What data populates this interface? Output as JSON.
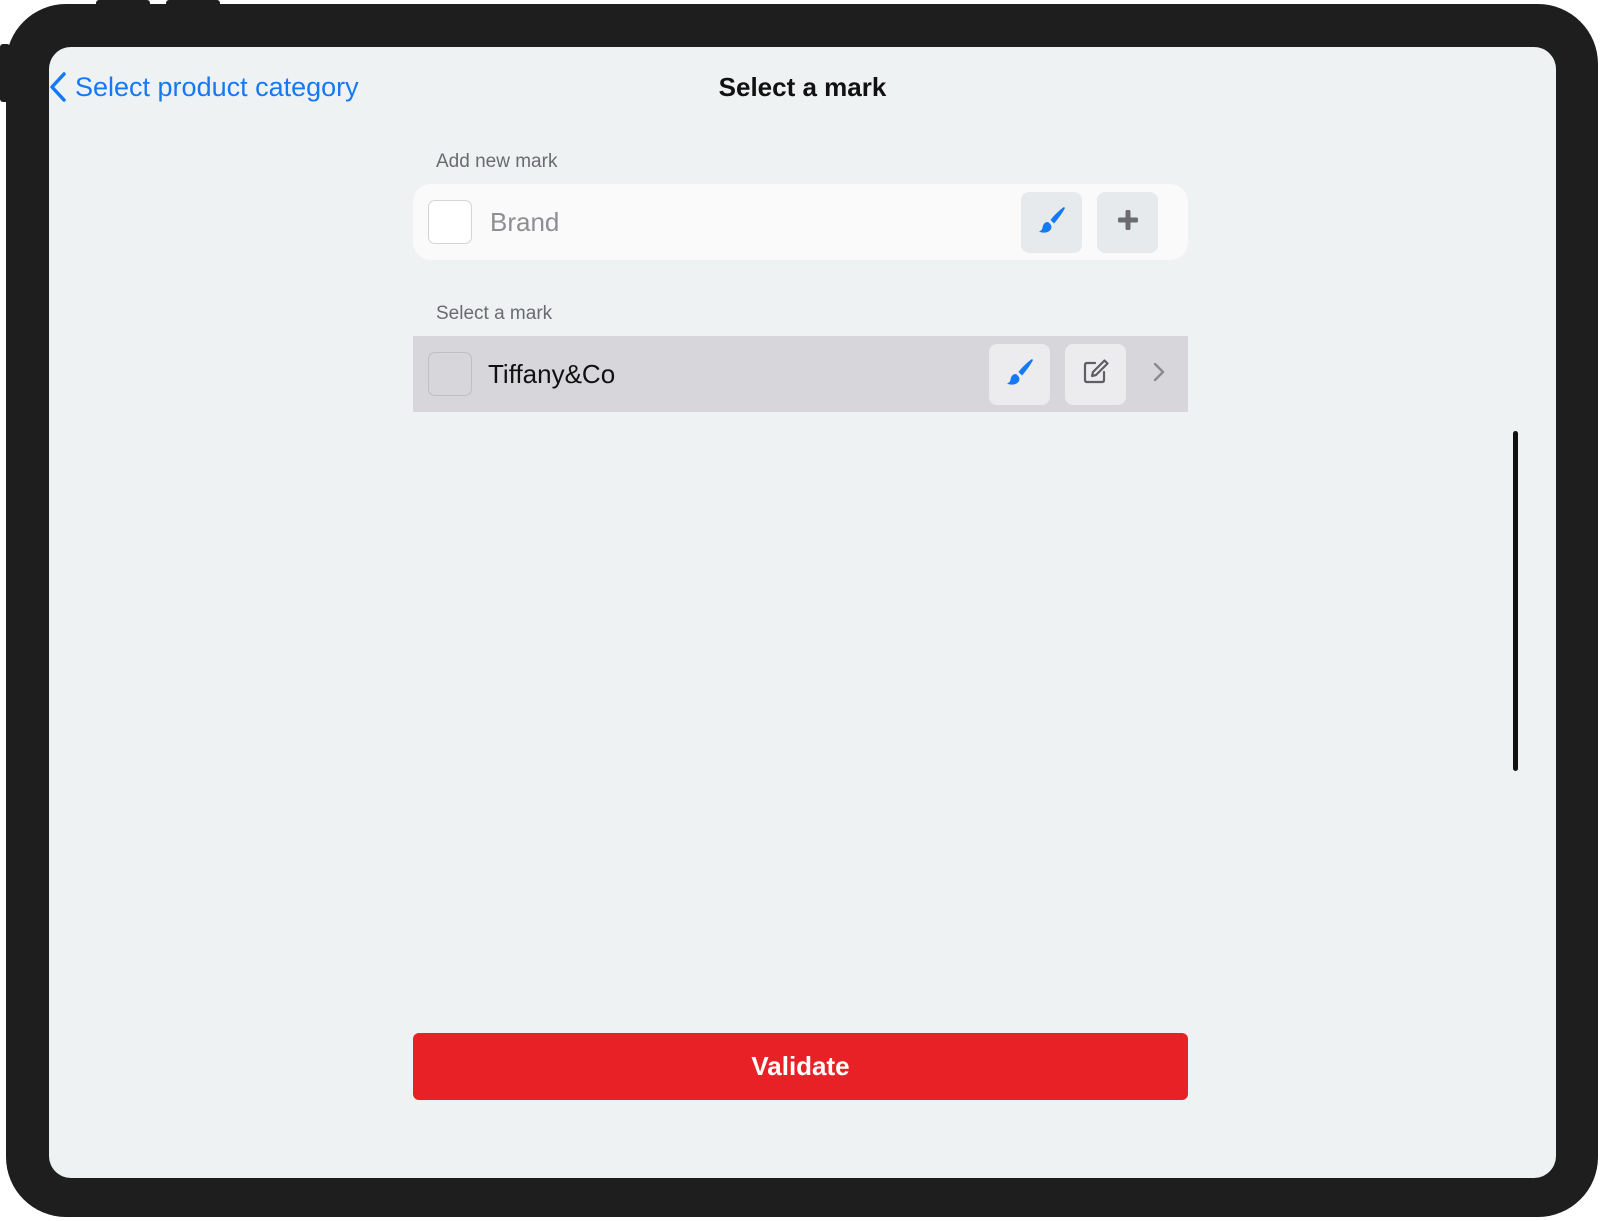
{
  "nav": {
    "back_label": "Select product category",
    "title": "Select a mark"
  },
  "add_section": {
    "label": "Add new mark",
    "input_placeholder": "Brand",
    "input_value": "",
    "brush_icon": "paintbrush-icon",
    "add_icon": "plus-icon"
  },
  "select_section": {
    "label": "Select a mark",
    "items": [
      {
        "name": "Tiffany&Co",
        "brush_icon": "paintbrush-icon",
        "edit_icon": "edit-icon",
        "chevron_icon": "chevron-right-icon"
      }
    ]
  },
  "footer": {
    "validate_label": "Validate"
  },
  "colors": {
    "accent": "#1479f5",
    "validate": "#e72126",
    "background": "#eff2f3",
    "selected_row": "#d6d6db"
  }
}
